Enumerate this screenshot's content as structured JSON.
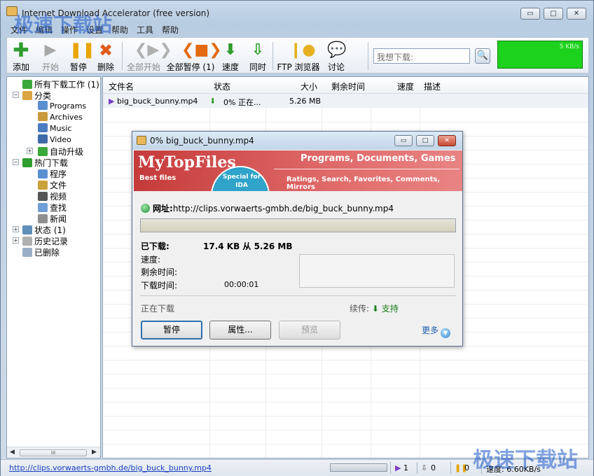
{
  "window": {
    "title": "Internet Download Accelerator (free version)",
    "caption_buttons": [
      "▭",
      "□",
      "✕"
    ]
  },
  "menu": [
    "文件",
    "编辑",
    "操作",
    "设置",
    "帮助",
    "工具",
    "帮助"
  ],
  "toolbar": {
    "buttons": [
      {
        "label": "添加",
        "icon": "add-plus-icon",
        "color": "#2f9e2f"
      },
      {
        "label": "开始",
        "icon": "play-icon",
        "color": "#9a9a9a"
      },
      {
        "label": "暂停",
        "icon": "pause-icon",
        "color": "#e9a400"
      },
      {
        "label": "删除",
        "icon": "delete-x-icon",
        "color": "#e05a1a"
      },
      {
        "label": "全部开始",
        "icon": "play-all-icon",
        "color": "#9a9a9a"
      },
      {
        "label": "全部暂停 (1)",
        "icon": "pause-all-icon",
        "color": "#e36a10"
      },
      {
        "label": "速度",
        "icon": "speed-arrow-icon",
        "color": "#2c9c2c"
      },
      {
        "label": "同时",
        "icon": "simultaneous-icon",
        "color": "#2c9c2c"
      },
      {
        "label": "FTP 浏览器",
        "icon": "ftp-browser-icon",
        "color": "#e6b020"
      },
      {
        "label": "讨论",
        "icon": "chat-bubble-icon",
        "color": "#2d8fd8"
      }
    ],
    "search_placeholder": "我想下载:",
    "speed_graph_label": "5 KB/s"
  },
  "tree": {
    "items": [
      {
        "label": "所有下载工作 (1)"
      },
      {
        "label": "分类"
      },
      {
        "label": "Programs"
      },
      {
        "label": "Archives"
      },
      {
        "label": "Music"
      },
      {
        "label": "Video"
      },
      {
        "label": "自动升级"
      },
      {
        "label": "热门下载"
      },
      {
        "label": "程序"
      },
      {
        "label": "文件"
      },
      {
        "label": "视频"
      },
      {
        "label": "查找"
      },
      {
        "label": "新闻"
      },
      {
        "label": "状态 (1)"
      },
      {
        "label": "历史记录"
      },
      {
        "label": "已删除"
      }
    ],
    "scroll_grip": "III"
  },
  "list": {
    "columns": [
      "文件名",
      "状态",
      "大小",
      "剩余时间",
      "速度",
      "描述"
    ],
    "rows": [
      {
        "file": "big_buck_bunny.mp4",
        "status": "0% 正在...",
        "size": "5.26 MB",
        "remaining": "",
        "speed": "",
        "desc": ""
      }
    ]
  },
  "dialog": {
    "title": "0% big_buck_bunny.mp4",
    "banner": {
      "brand": "MyTopFiles",
      "tagline": "Best files",
      "special": "Special for IDA",
      "headline": "Programs, Documents, Games",
      "subline": "Ratings, Search, Favorites, Comments, Mirrors"
    },
    "url_label": "网址:",
    "url": "http://clips.vorwaerts-gmbh.de/big_buck_bunny.mp4",
    "progress_fraction": 0.0,
    "downloaded_label": "已下载:",
    "downloaded_value": "17.4 KB 从 5.26 MB",
    "speed_label": "速度:",
    "remaining_label": "剩余时间:",
    "elapsed_label": "下载时间:",
    "elapsed_value": "00:00:01",
    "status_text": "正在下载",
    "resume_label": "续传:",
    "resume_value": "支持",
    "buttons": {
      "pause": "暂停",
      "properties": "属性...",
      "preview": "预览"
    },
    "more": "更多"
  },
  "statusbar": {
    "url": "http://clips.vorwaerts-gmbh.de/big_buck_bunny.mp4",
    "active": "1",
    "queued": "0",
    "paused": "0",
    "speed": "速度: 6.60KB/s"
  },
  "watermark": {
    "top": "极速下载站",
    "bottom": "极速下载站"
  }
}
